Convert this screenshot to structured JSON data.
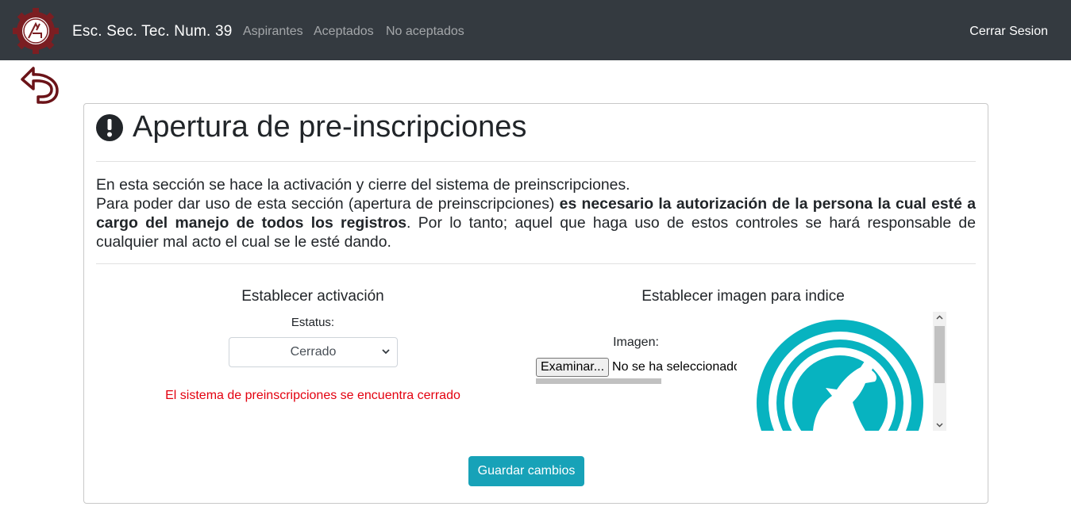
{
  "navbar": {
    "brand": "Esc. Sec. Tec. Num. 39",
    "links": [
      "Aspirantes",
      "Aceptados",
      "No aceptados"
    ],
    "logout": "Cerrar Sesion"
  },
  "icons": {
    "logo": "school-gear-logo",
    "back": "undo-arrow-icon",
    "alert": "exclamation-circle-icon"
  },
  "colors": {
    "navbar_bg": "#343a40",
    "accent": "#17a2b8",
    "error": "#e3000f",
    "logo_maroon": "#7b1e22"
  },
  "card": {
    "title": "Apertura de pre-inscripciones",
    "intro_line1": "En esta sección se hace la activación y cierre del sistema de preinscripciones.",
    "intro_p2_start": "Para poder dar uso de esta sección (apertura de preinscripciones) ",
    "intro_p2_bold": "es necesario la autorización de la persona la cual esté a cargo del manejo de todos los registros",
    "intro_p2_end": ". Por lo tanto; aquel que haga uso de estos controles se hará responsable de cualquier mal acto el cual se le esté dando."
  },
  "activation": {
    "heading": "Establecer activación",
    "status_label": "Estatus:",
    "status_value": "Cerrado",
    "status_message": "El sistema de preinscripciones se encuentra cerrado"
  },
  "index_image": {
    "heading": "Establecer imagen para indice",
    "image_label": "Imagen:",
    "file_button": "Examinar...",
    "file_status": "No se ha seleccionado"
  },
  "save_button": "Guardar cambios"
}
